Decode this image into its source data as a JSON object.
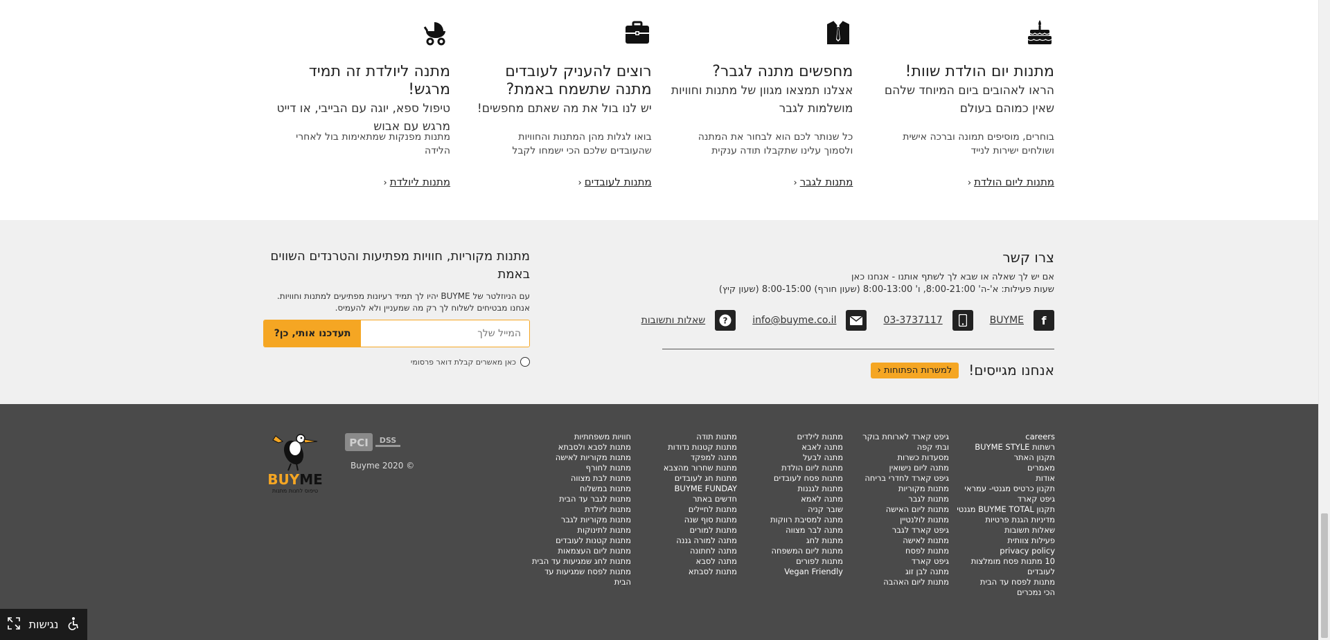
{
  "features": [
    {
      "icon": "cake-icon",
      "title": "מתנות יום הולדת שוות!",
      "subtitle": "הראו לאהובים ביום המיוחד שלהם שאין כמוהם בעולם",
      "description": "בוחרים, מוסיפים תמונה וברכה אישית ושולחים ישירות לנייד",
      "link": "מתנות ליום הולדת"
    },
    {
      "icon": "shirt-tie-icon",
      "title": "מחפשים מתנה לגבר?",
      "subtitle": "אצלנו תמצאו מגוון של מתנות וחוויות מושלמות לגבר",
      "description": "כל שנותר לכם הוא לבחור את המתנה ולסמוך עלינו שתקבלו תודה ענקית",
      "link": "מתנות לגבר"
    },
    {
      "icon": "briefcase-icon",
      "title": "רוצים להעניק לעובדים מתנה שתשמח באמת?",
      "subtitle": "יש לנו בול את מה שאתם מחפשים!",
      "description": "בואו לגלות מהן המתנות והחוויות שהעובדים שלכם הכי ישמחו לקבל",
      "link": "מתנות לעובדים"
    },
    {
      "icon": "baby-stroller-icon",
      "title": "מתנה ליולדת זה תמיד מרגש!",
      "subtitle": "טיפול ספא, יוגה עם הבייבי, או דייט מרגש עם אבוש",
      "description": "מתנות מפנקות שמתאימות בול לאחרי הלידה",
      "link": "מתנות ליולדת"
    }
  ],
  "contact": {
    "title": "צרו קשר",
    "line1": "אם יש לך שאלה או שבא לך לשתף אותנו - אנחנו כאן",
    "line2": "שעות פעילות: א'-ה' 8:00-21:00, ו' 8:00-13:00 (שעון חורף) 8:00-15:00 (שעון קיץ)",
    "facebook": "BUYME",
    "phone": "03-3737117",
    "email": "info@buyme.co.il",
    "faq": "שאלות ותשובות",
    "recruiting_text": "אנחנו מגייסים!",
    "jobs_button": "למשרות הפתוחות"
  },
  "newsletter": {
    "title": "מתנות מקוריות, חוויות מפתיעות והטרנדים השווים באמת",
    "description": "עם הניוזלטר של BUYME יהיו לך תמיד רעיונות מפתיעים למתנות וחוויות. אנחנו מבטיחים לשלוח לך רק מה שמעניין ולא להעמיס.",
    "placeholder": "המייל שלך",
    "button": "תעדכנו אותי, כן?",
    "consent": "כאן מאשרים קבלת דואר פרסומי"
  },
  "footer": {
    "columns": [
      [
        "careers",
        "רשתות BUYME STYLE",
        "תקנון האתר",
        "מאמרים",
        "אודות",
        "תקנון כרטיס מגנטי- עמראי",
        "גיפט קארד",
        "תקנון BUYME TOTAL מגנטי",
        "מדיניות הגנת פרטיות",
        "שאלות תשובות",
        "פעילות צוותית",
        "privacy policy",
        "10 מתנות פסח מומלצות לעובדים",
        "מתנות לפסח עד הבית",
        "הכי נמכרים"
      ],
      [
        "גיפט קארד לארוחת בוקר",
        "ובתי קפה",
        "מסעדות כשרות",
        "מתנה ליום נישואין",
        "גיפט קארד לחדרי בריחה",
        "מתנות מקוריות",
        "מתנות לגבר",
        "מתנות ליום האישה",
        "מתנות לולנטיין",
        "גיפט קארד לגבר",
        "מתנות לאישה",
        "מתנות לפסח",
        "גיפט קארד",
        "מתנה לבן זוג",
        "מתנות ליום האהבה"
      ],
      [
        "מתנות לילדים",
        "מתנה לאבא",
        "מתנה לבעל",
        "מתנות ליום הולדת",
        "מתנות פסח לעובדים",
        "מתנות לגננות",
        "מתנה לאמא",
        "שובר קניה",
        "מתנה למסיבת רווקות",
        "מתנה לבר מצווה",
        "מתנות לחג",
        "מתנות ליום המשפחה",
        "מתנות לפורים",
        "Vegan Friendly"
      ],
      [
        "מתנות תודה",
        "מתנות קטנות נדודות",
        "מתנה למפקד",
        "מתנות שחרור מהצבא",
        "מתנות חג לעובדים",
        "BUYME FUNDAY",
        "חדשים באתר",
        "מתנות לחיילים",
        "מתנות סוף שנה",
        "מתנות למורים",
        "מתנה למורה גננה",
        "מתנה לחתונה",
        "מתנה לסבא",
        "מתנות לסבתא"
      ],
      [
        "חוויות משפחתיות",
        "מתנות לסבא ולסבתא",
        "מתנות מקוריות לאישה",
        "מתנות לחורף",
        "מתנות לבת מצווה",
        "מתנות במשלוח",
        "מתנות לגבר עד הבית",
        "מתנות ליולדת",
        "מתנות מקוריות לגבר",
        "מתנות לתינוקות",
        "מתנות קטנות לעובדים",
        "מתנות ליום העצמאות",
        "מתנות לחג שמגיעות עד הבית",
        "מתנות לפסח שמגיעות עד הבית"
      ]
    ],
    "logo_text": "BUYME",
    "logo_tagline": "טיפוס לחנות מתנות",
    "pci_text": "PCI DSS",
    "copyright": "© Buyme 2020"
  },
  "accessibility": {
    "label": "נגישות"
  },
  "colors": {
    "accent": "#f5a623",
    "band_bg": "#f0f0f0",
    "footer_bg": "#4a4a4a"
  }
}
